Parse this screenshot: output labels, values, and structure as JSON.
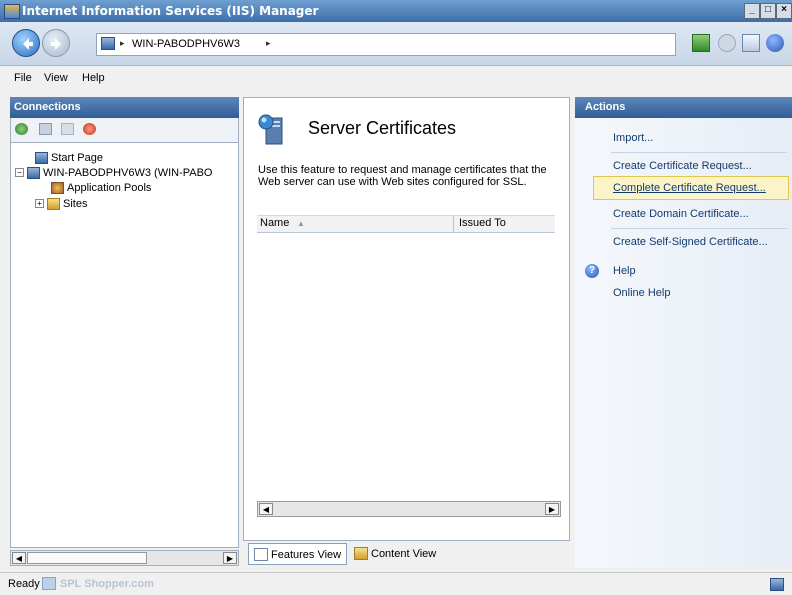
{
  "window": {
    "title": "Internet Information Services (IIS) Manager",
    "minimize": "_",
    "maximize": "□",
    "close": "×"
  },
  "address": {
    "server": "WIN-PABODPHV6W3",
    "sep1": "▸",
    "sep2": "▸"
  },
  "menu": {
    "file": "File",
    "view": "View",
    "help": "Help"
  },
  "connections": {
    "header": "Connections",
    "tree": [
      {
        "label": "Start Page",
        "icon": "start-page-icon"
      },
      {
        "label": "WIN-PABODPHV6W3 (WIN-PABO",
        "icon": "server-icon"
      },
      {
        "label": "Application Pools",
        "icon": "app-pools-icon"
      },
      {
        "label": "Sites",
        "icon": "sites-folder-icon"
      }
    ]
  },
  "main": {
    "title": "Server Certificates",
    "description": "Use this feature to request and manage certificates that the Web server can use with Web sites configured for SSL.",
    "columns": [
      "Name",
      "Issued To"
    ],
    "sort_arrow": "▲"
  },
  "view_tabs": {
    "features": "Features View",
    "content": "Content View"
  },
  "actions": {
    "header": "Actions",
    "items": [
      "Import...",
      "Create Certificate Request...",
      "Complete Certificate Request...",
      "Create Domain Certificate...",
      "Create Self-Signed Certificate...",
      "Help",
      "Online Help"
    ]
  },
  "status": {
    "text": "Ready",
    "watermark": "SPL Shopper.com"
  },
  "colors": {
    "header_blue": "#2f5d97",
    "link_blue": "#123b70",
    "highlight": "#fbf4c8"
  }
}
